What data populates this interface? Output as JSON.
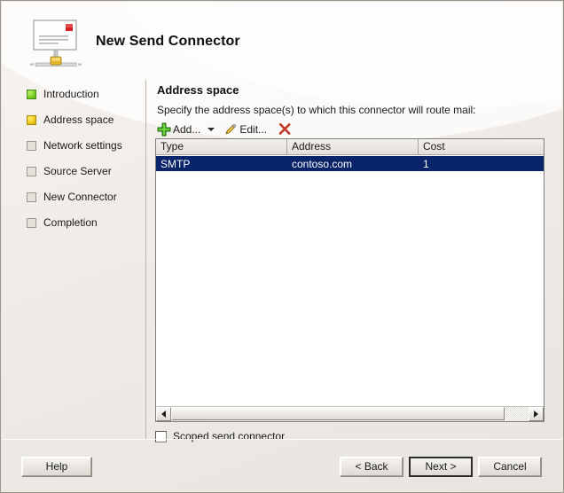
{
  "window": {
    "title": "New Send Connector",
    "icon": "send-connector-icon"
  },
  "sidebar": {
    "steps": [
      {
        "label": "Introduction",
        "state": "done"
      },
      {
        "label": "Address space",
        "state": "current"
      },
      {
        "label": "Network settings",
        "state": "pending"
      },
      {
        "label": "Source Server",
        "state": "pending"
      },
      {
        "label": "New Connector",
        "state": "pending"
      },
      {
        "label": "Completion",
        "state": "pending"
      }
    ]
  },
  "content": {
    "section_title": "Address space",
    "instruction": "Specify the address space(s) to which this connector will route mail:",
    "toolbar": {
      "add_label": "Add...",
      "add_icon": "green-plus-icon",
      "dropdown_icon": "chevron-down-icon",
      "edit_label": "Edit...",
      "edit_icon": "pencil-icon",
      "remove_icon": "red-x-icon"
    },
    "listview": {
      "columns": [
        "Type",
        "Address",
        "Cost"
      ],
      "rows": [
        {
          "type": "SMTP",
          "address": "contoso.com",
          "cost": "1",
          "selected": true
        }
      ]
    },
    "scoped_checkbox": {
      "label": "Scoped send connector",
      "checked": false
    }
  },
  "footer": {
    "help_label": "Help",
    "back_label": "< Back",
    "next_label": "Next >",
    "cancel_label": "Cancel"
  },
  "colors": {
    "selection_blue": "#0a246a",
    "step_done_green": "#82d42a",
    "step_current_yellow": "#f5cf1e",
    "add_icon_green": "#3faa1e",
    "remove_icon_red": "#c0392b",
    "dialog_background": "#ece9e4"
  }
}
